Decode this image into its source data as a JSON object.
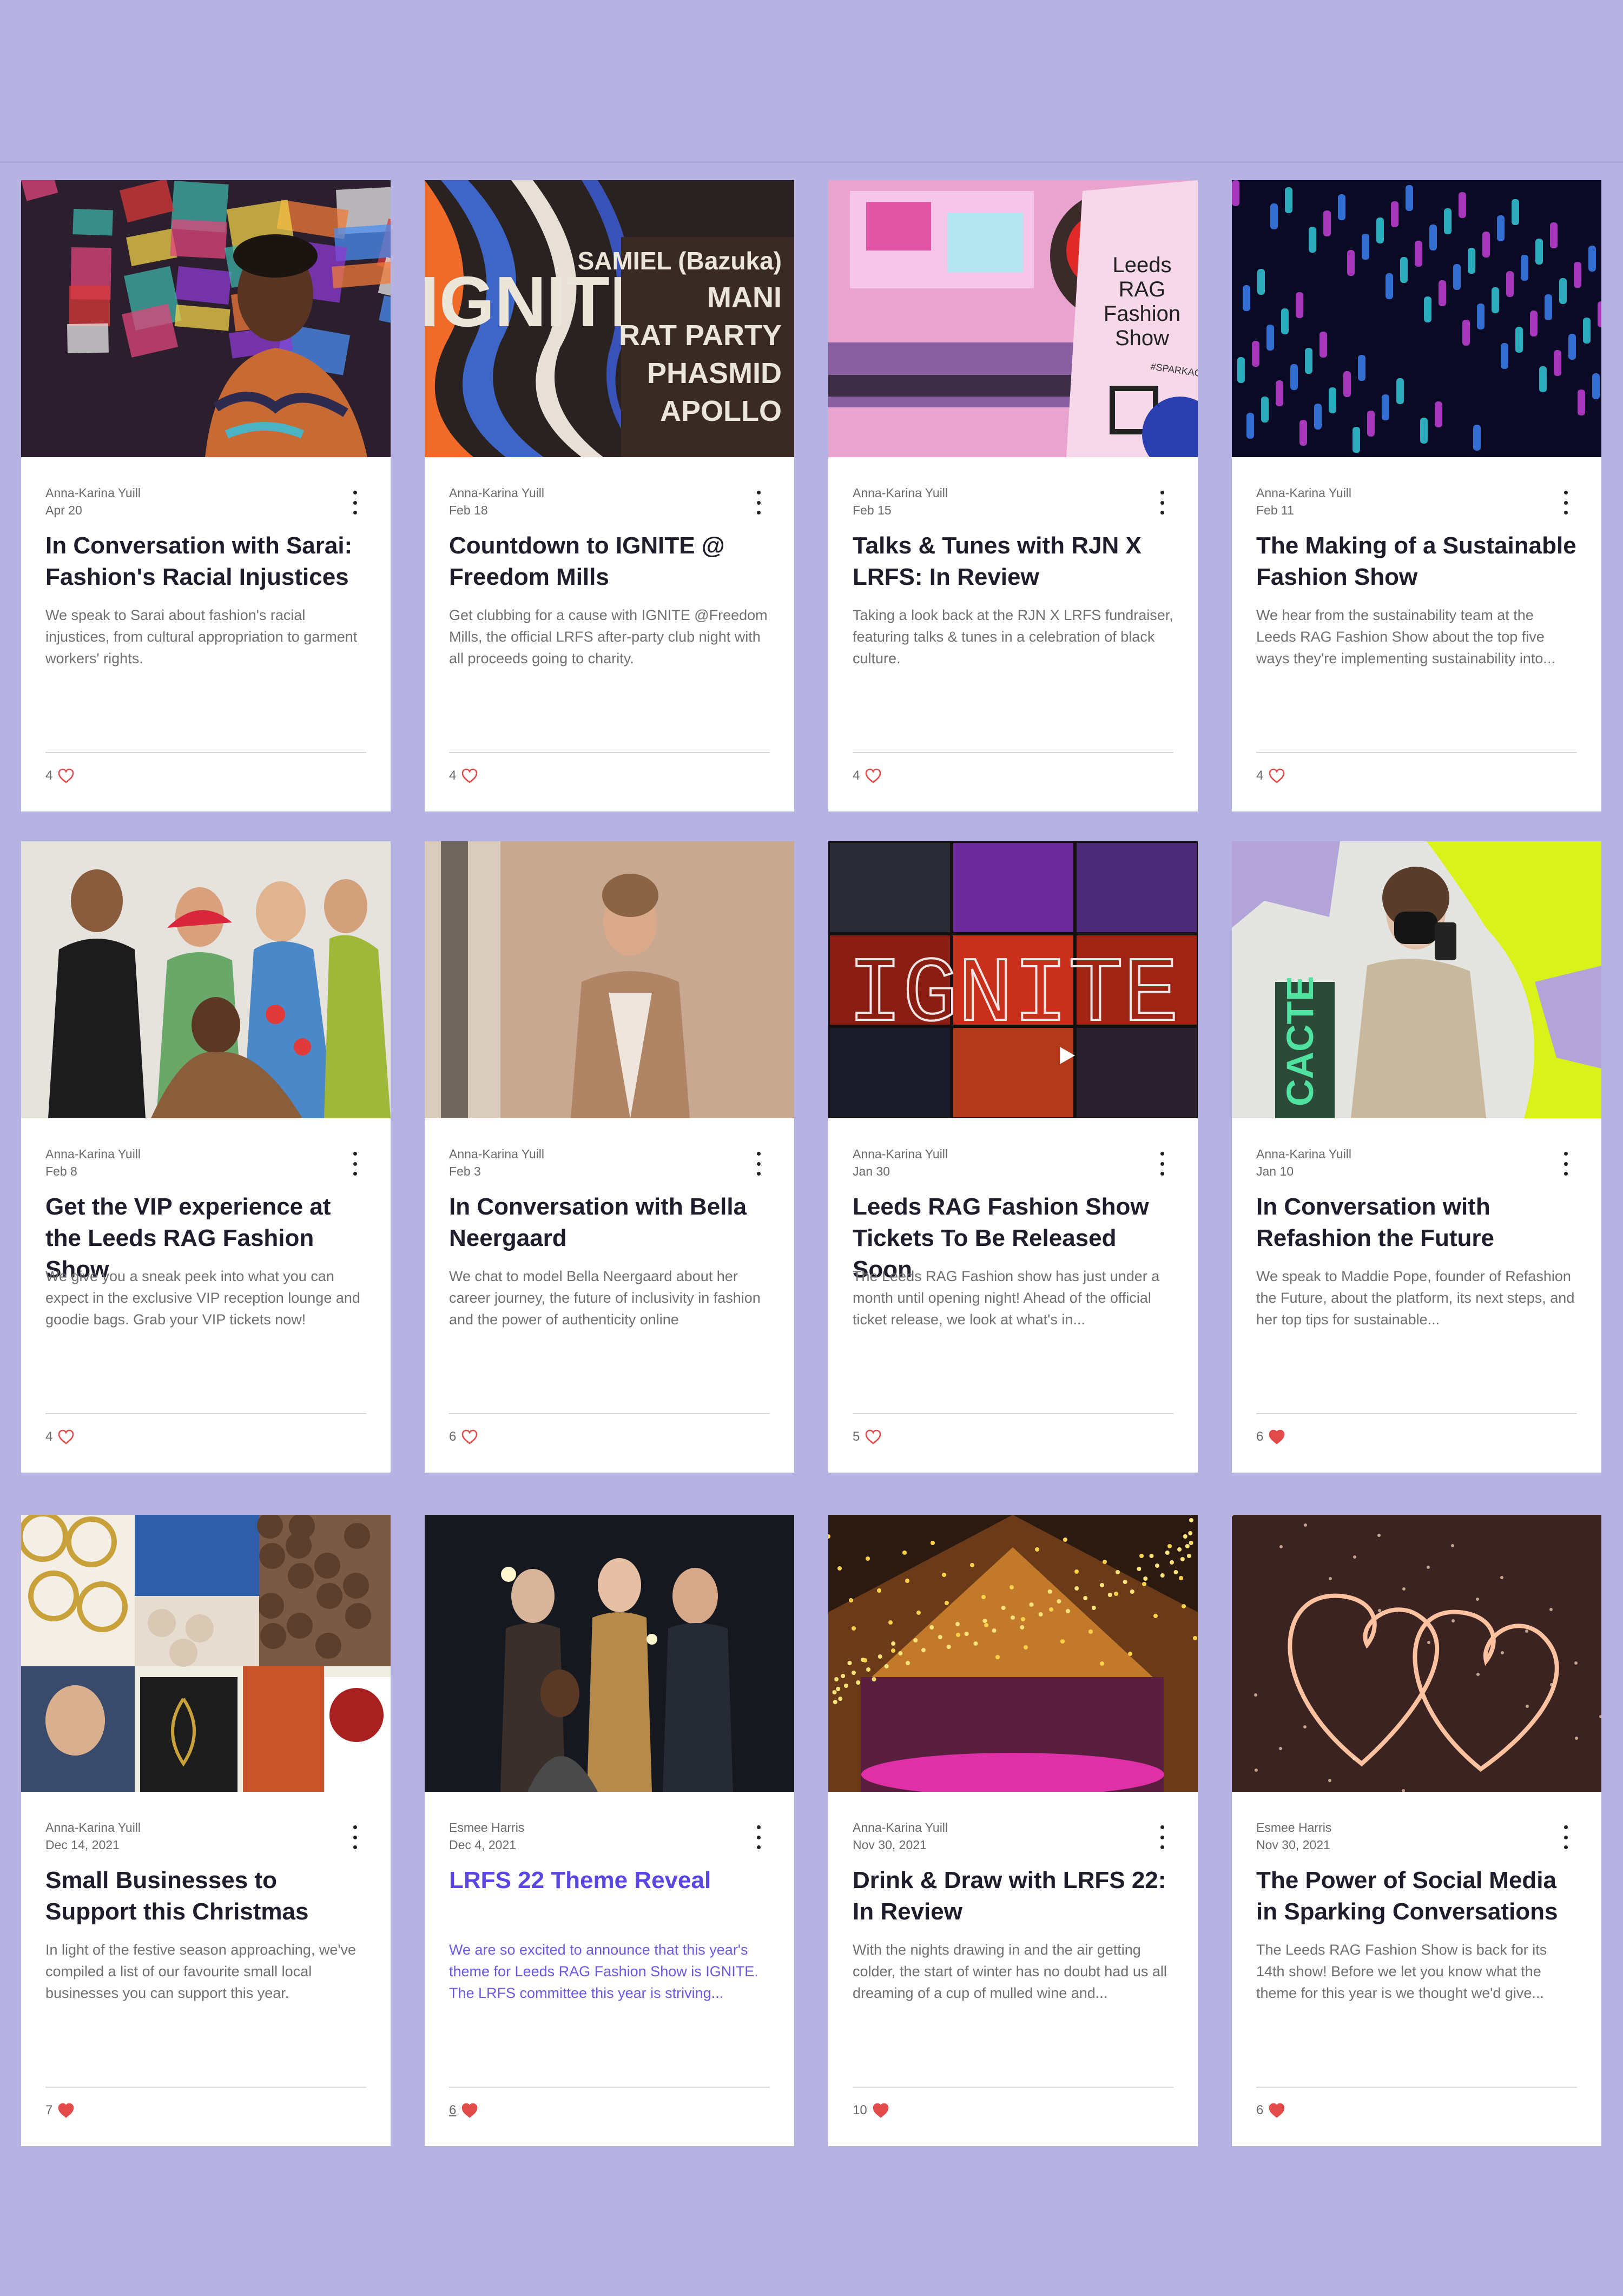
{
  "colors": {
    "background": "#b6b3e3",
    "card": "#ffffff",
    "heart": "#e34a4a",
    "highlight": "#5a46e0"
  },
  "posts": [
    {
      "author": "Anna-Karina Yuill",
      "date": "Apr 20",
      "title": "In Conversation with Sarai: Fashion's Racial Injustices",
      "excerpt": "We speak to Sarai about fashion's racial injustices, from cultural appropriation to garment workers' rights.",
      "likes": "4",
      "liked": false,
      "image": "graffiti-portrait",
      "image_text": []
    },
    {
      "author": "Anna-Karina Yuill",
      "date": "Feb 18",
      "title": "Countdown to IGNITE @ Freedom Mills",
      "excerpt": "Get clubbing for a cause with IGNITE @Freedom Mills, the official LRFS after-party club night with all proceeds going to charity.",
      "likes": "4",
      "liked": false,
      "image": "ignite-poster",
      "image_text": [
        "IGNITE",
        "SAMIEL (Bazuka)",
        "MANI",
        "RAT PARTY",
        "PHASMID",
        "APOLLO"
      ]
    },
    {
      "author": "Anna-Karina Yuill",
      "date": "Feb 15",
      "title": "Talks & Tunes with RJN X LRFS: In Review",
      "excerpt": "Taking a look back at the RJN X LRFS fundraiser, featuring talks & tunes in a celebration of black culture.",
      "likes": "4",
      "liked": false,
      "image": "stage-banner",
      "image_text": [
        "Leeds RAG Fashion Show",
        "#SPARKACONVERSATION"
      ]
    },
    {
      "author": "Anna-Karina Yuill",
      "date": "Feb 11",
      "title": "The Making of a Sustainable Fashion Show",
      "excerpt": "We hear from the sustainability team at the Leeds RAG Fashion Show about the top five ways they're implementing sustainability into...",
      "likes": "4",
      "liked": false,
      "image": "bottle-installation",
      "image_text": []
    },
    {
      "author": "Anna-Karina Yuill",
      "date": "Feb 8",
      "title": "Get the VIP experience at the Leeds RAG Fashion Show",
      "excerpt": "We give you a sneak peek into what you can expect in the exclusive VIP reception lounge and goodie bags. Grab your VIP tickets now!",
      "likes": "4",
      "liked": false,
      "image": "group-photo",
      "image_text": []
    },
    {
      "author": "Anna-Karina Yuill",
      "date": "Feb 3",
      "title": "In Conversation with Bella Neergaard",
      "excerpt": "We chat to model Bella Neergaard about her career journey, the future of inclusivity in fashion and the power of authenticity online",
      "likes": "6",
      "liked": false,
      "image": "model-portrait",
      "image_text": []
    },
    {
      "author": "Anna-Karina Yuill",
      "date": "Jan 30",
      "title": "Leeds RAG Fashion Show Tickets To Be Released Soon",
      "excerpt": "The Leeds RAG Fashion show has just under a month until opening night! Ahead of the official ticket release, we look at what's in...",
      "likes": "5",
      "liked": false,
      "image": "ignite-video",
      "image_text": [
        "IGNITE"
      ]
    },
    {
      "author": "Anna-Karina Yuill",
      "date": "Jan 10",
      "title": "In Conversation with Refashion the Future",
      "excerpt": "We speak to Maddie Pope, founder of Refashion the Future, about the platform, its next steps, and her top tips for sustainable...",
      "likes": "6",
      "liked": true,
      "image": "neon-selfie",
      "image_text": [
        "CACTE"
      ]
    },
    {
      "author": "Anna-Karina Yuill",
      "date": "Dec 14, 2021",
      "title": "Small Businesses to Support this Christmas",
      "excerpt": "In light of the festive season approaching, we've compiled a list of our favourite small local businesses you can support this year.",
      "likes": "7",
      "liked": true,
      "image": "collage",
      "image_text": []
    },
    {
      "author": "Esmee Harris",
      "date": "Dec 4, 2021",
      "title": "LRFS 22 Theme Reveal",
      "excerpt": "We are so excited to announce that this year's theme for Leeds RAG Fashion Show is IGNITE. The LRFS committee this year is striving...",
      "likes": "6",
      "liked": true,
      "highlight": true,
      "image": "sparkler-group",
      "image_text": []
    },
    {
      "author": "Anna-Karina Yuill",
      "date": "Nov 30, 2021",
      "title": "Drink & Draw with LRFS 22: In Review",
      "excerpt": "With the nights drawing in and the air getting colder, the start of winter has no doubt had us all dreaming of a cup of mulled wine and...",
      "likes": "10",
      "liked": true,
      "image": "tent-lights",
      "image_text": []
    },
    {
      "author": "Esmee Harris",
      "date": "Nov 30, 2021",
      "title": "The Power of Social Media in Sparking Conversations",
      "excerpt": "The Leeds RAG Fashion Show is back for its 14th show! Before we let you know what the theme for this year is we thought we'd give...",
      "likes": "6",
      "liked": true,
      "image": "sparkler-hearts",
      "image_text": []
    }
  ]
}
